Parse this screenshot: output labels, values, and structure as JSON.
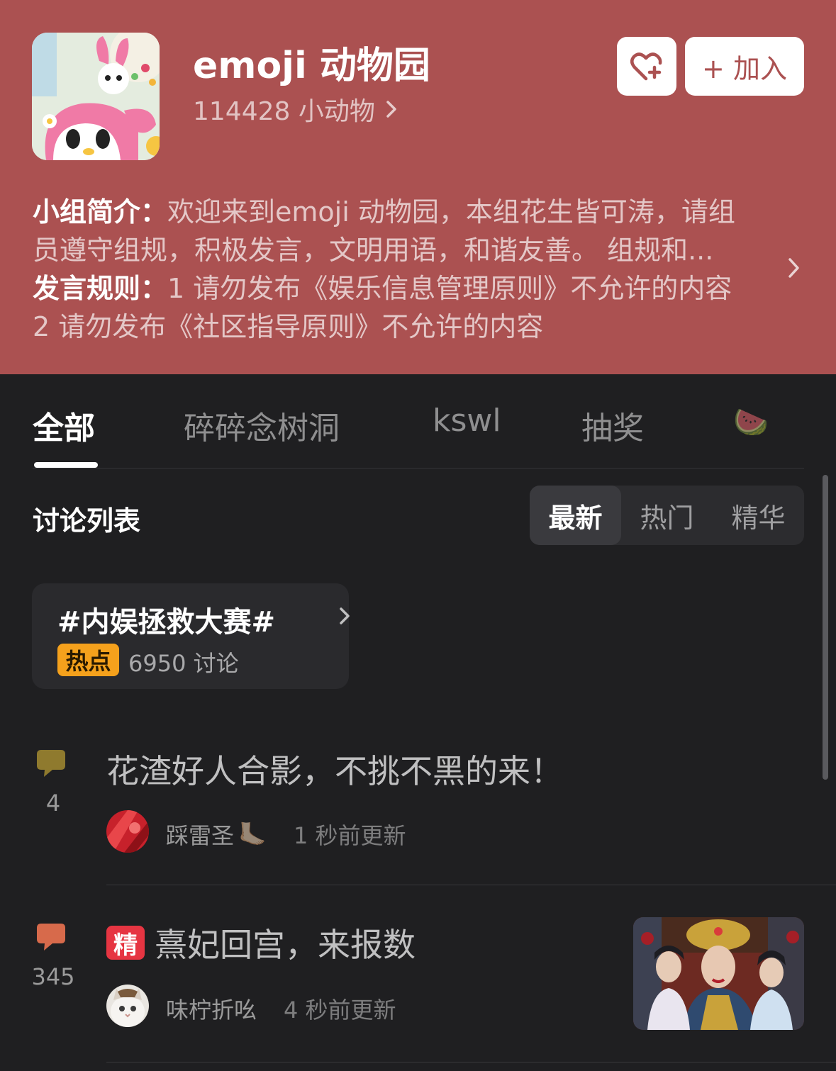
{
  "group": {
    "name": "emoji 动物园",
    "member_text": "114428 小动物",
    "join_label": "+ 加入",
    "intro_label": "小组简介：",
    "intro_line1": "欢迎来到emoji 动物园，本组花生皆可涛，请组",
    "intro_line2": "员遵守组规，积极发言，文明用语，和谐友善。 组规和...",
    "rules_label": "发言规则：",
    "rules_line1": "1 请勿发布《娱乐信息管理原则》不允许的内容",
    "rules_line2": "2 请勿发布《社区指导原则》不允许的内容"
  },
  "tabs": [
    "全部",
    "碎碎念树洞",
    "kswl",
    "抽奖",
    "🍉"
  ],
  "list": {
    "title": "讨论列表",
    "sort_options": [
      "最新",
      "热门",
      "精华"
    ]
  },
  "topic": {
    "title": "#内娱拯救大赛#",
    "badge": "热点",
    "count": "6950 讨论"
  },
  "posts": [
    {
      "count": "4",
      "title": "花渣好人合影，不挑不黑的来！",
      "author": "踩雷圣",
      "author_emoji": "🦶🏻",
      "time": "1 秒前更新",
      "icon_color": "#8f7a2e"
    },
    {
      "count": "345",
      "badge": "精",
      "title": "熹妃回宫，来报数",
      "author": "味柠折吆",
      "time": "4 秒前更新",
      "icon_color": "#d76a4b"
    }
  ],
  "icons": {
    "favorite": "heart-plus-icon",
    "arrow": "chevron-right-icon",
    "comment": "comment-bubble-icon"
  }
}
